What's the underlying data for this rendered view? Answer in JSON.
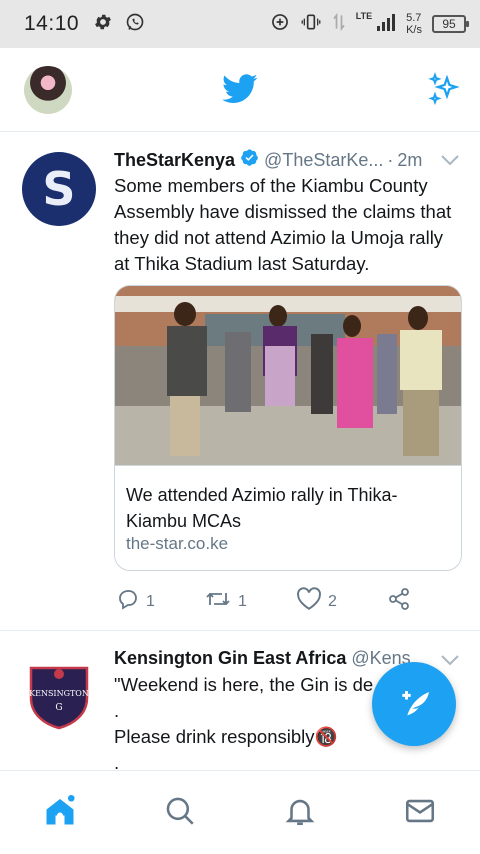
{
  "status_bar": {
    "time": "14:10",
    "network_type": "LTE",
    "speed_value": "5.7",
    "speed_unit": "K/s",
    "battery": "95"
  },
  "app_bar": {
    "logo": "twitter-bird-icon",
    "accent_color": "#1da1f2"
  },
  "tweets": [
    {
      "name": "TheStarKenya",
      "verified": true,
      "handle": "@TheStarKe...",
      "separator": "·",
      "time": "2m",
      "avatar_letter": "S",
      "text": "Some members of the Kiambu County Assembly have dismissed the claims that they did not attend Azimio la Umoja rally at Thika Stadium last Saturday.",
      "card": {
        "title": "We attended Azimio rally in Thika- Kiambu MCAs",
        "domain": "the-star.co.ke"
      },
      "actions": {
        "replies": "1",
        "retweets": "1",
        "likes": "2"
      }
    },
    {
      "name": "Kensington Gin East Africa",
      "handle": "@Kens",
      "avatar_text": "KENSINGTON",
      "text_line1": "\"Weekend is here, the Gin is de",
      "text_line2": ".",
      "text_line3": "Please drink responsibly🔞",
      "text_line4": "."
    }
  ],
  "bottom_nav": [
    {
      "icon": "home-icon",
      "active": true
    },
    {
      "icon": "search-icon",
      "active": false
    },
    {
      "icon": "notifications-bell-icon",
      "active": false
    },
    {
      "icon": "messages-envelope-icon",
      "active": false
    }
  ]
}
